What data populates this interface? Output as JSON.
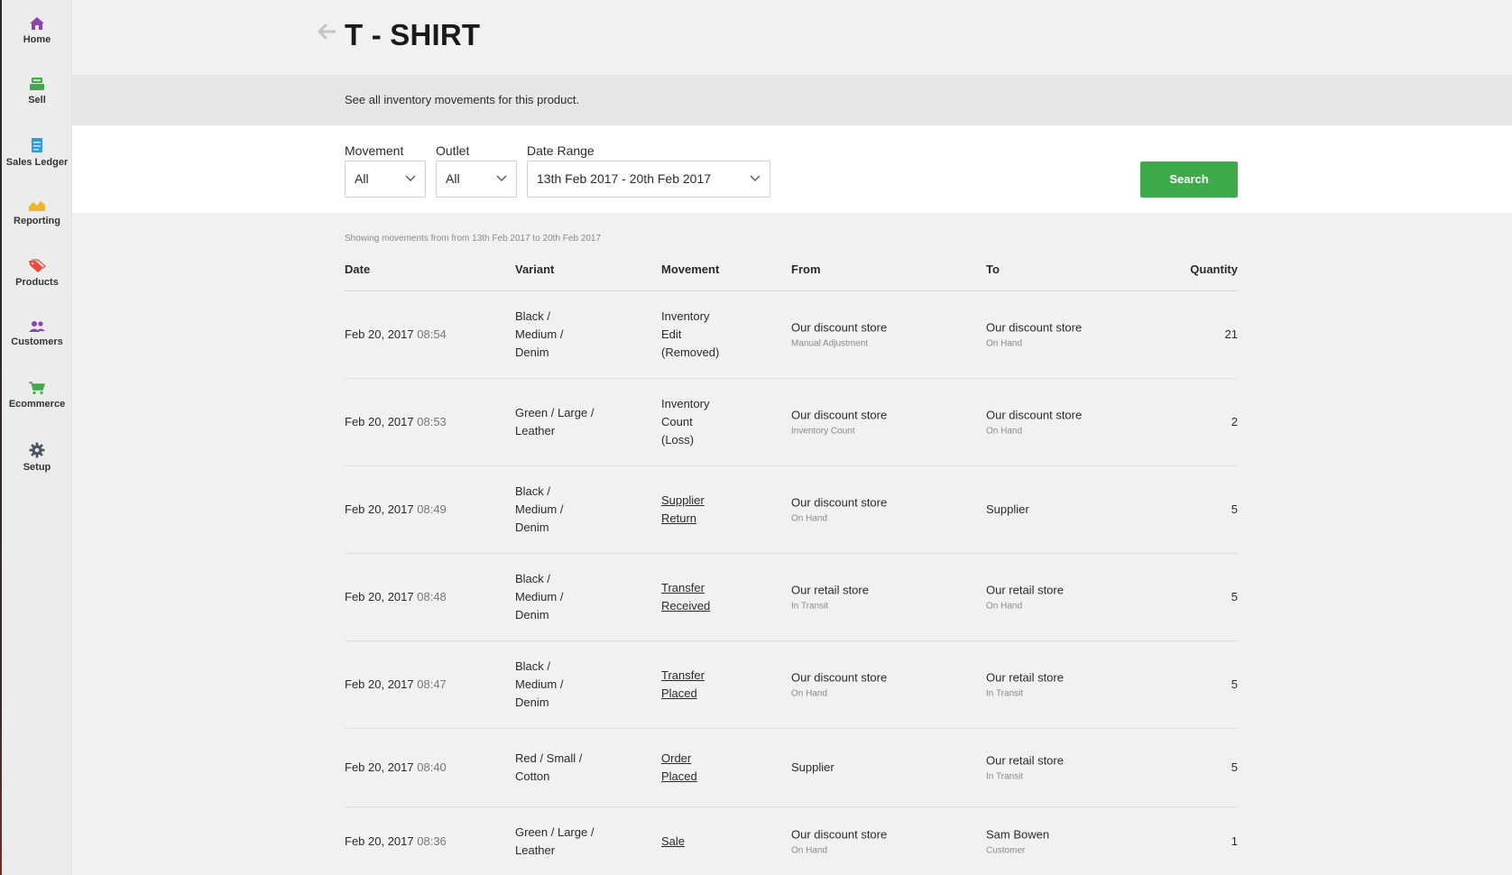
{
  "sidebar": {
    "items": [
      {
        "label": "Home",
        "icon": "home-icon",
        "color": "#8e44ad"
      },
      {
        "label": "Sell",
        "icon": "register-icon",
        "color": "#3eaa4a"
      },
      {
        "label": "Sales Ledger",
        "icon": "ledger-icon",
        "color": "#3498db"
      },
      {
        "label": "Reporting",
        "icon": "chart-icon",
        "color": "#f0b429"
      },
      {
        "label": "Products",
        "icon": "tag-icon",
        "color": "#e74c3c"
      },
      {
        "label": "Customers",
        "icon": "users-icon",
        "color": "#8e44ad"
      },
      {
        "label": "Ecommerce",
        "icon": "cart-icon",
        "color": "#3eaa4a"
      },
      {
        "label": "Setup",
        "icon": "gear-icon",
        "color": "#4a5568"
      }
    ]
  },
  "header": {
    "title": "T - SHIRT",
    "subtitle": "See all inventory movements for this product."
  },
  "filters": {
    "movement_label": "Movement",
    "movement_value": "All",
    "outlet_label": "Outlet",
    "outlet_value": "All",
    "date_range_label": "Date Range",
    "date_range_value": "13th Feb 2017 - 20th Feb 2017",
    "search_label": "Search"
  },
  "showing_text": "Showing movements from from 13th Feb 2017 to 20th Feb 2017",
  "table": {
    "headers": {
      "date": "Date",
      "variant": "Variant",
      "movement": "Movement",
      "from": "From",
      "to": "To",
      "quantity": "Quantity"
    },
    "rows": [
      {
        "date": "Feb 20, 2017",
        "time": "08:54",
        "variant": [
          "Black /",
          "Medium /",
          "Denim"
        ],
        "movement": [
          "Inventory",
          "Edit",
          "(Removed)"
        ],
        "movement_link": false,
        "from": "Our discount store",
        "from_sub": "Manual Adjustment",
        "to": "Our discount store",
        "to_sub": "On Hand",
        "quantity": "21"
      },
      {
        "date": "Feb 20, 2017",
        "time": "08:53",
        "variant": [
          "Green / Large /",
          "Leather"
        ],
        "movement": [
          "Inventory",
          "Count",
          "(Loss)"
        ],
        "movement_link": false,
        "from": "Our discount store",
        "from_sub": "Inventory Count",
        "to": "Our discount store",
        "to_sub": "On Hand",
        "quantity": "2"
      },
      {
        "date": "Feb 20, 2017",
        "time": "08:49",
        "variant": [
          "Black /",
          "Medium /",
          "Denim"
        ],
        "movement": [
          "Supplier",
          "Return"
        ],
        "movement_link": true,
        "from": "Our discount store",
        "from_sub": "On Hand",
        "to": "Supplier",
        "to_sub": "",
        "quantity": "5"
      },
      {
        "date": "Feb 20, 2017",
        "time": "08:48",
        "variant": [
          "Black /",
          "Medium /",
          "Denim"
        ],
        "movement": [
          "Transfer",
          "Received"
        ],
        "movement_link": true,
        "from": "Our retail store",
        "from_sub": "In Transit",
        "to": "Our retail store",
        "to_sub": "On Hand",
        "quantity": "5"
      },
      {
        "date": "Feb 20, 2017",
        "time": "08:47",
        "variant": [
          "Black /",
          "Medium /",
          "Denim"
        ],
        "movement": [
          "Transfer",
          "Placed"
        ],
        "movement_link": true,
        "from": "Our discount store",
        "from_sub": "On Hand",
        "to": "Our retail store",
        "to_sub": "In Transit",
        "quantity": "5"
      },
      {
        "date": "Feb 20, 2017",
        "time": "08:40",
        "variant": [
          "Red / Small /",
          "Cotton"
        ],
        "movement": [
          "Order",
          "Placed"
        ],
        "movement_link": true,
        "from": "Supplier",
        "from_sub": "",
        "to": "Our retail store",
        "to_sub": "In Transit",
        "quantity": "5"
      },
      {
        "date": "Feb 20, 2017",
        "time": "08:36",
        "variant": [
          "Green / Large /",
          "Leather"
        ],
        "movement": [
          "Sale"
        ],
        "movement_link": true,
        "from": "Our discount store",
        "from_sub": "On Hand",
        "to": "Sam Bowen",
        "to_sub": "Customer",
        "quantity": "1"
      }
    ]
  }
}
